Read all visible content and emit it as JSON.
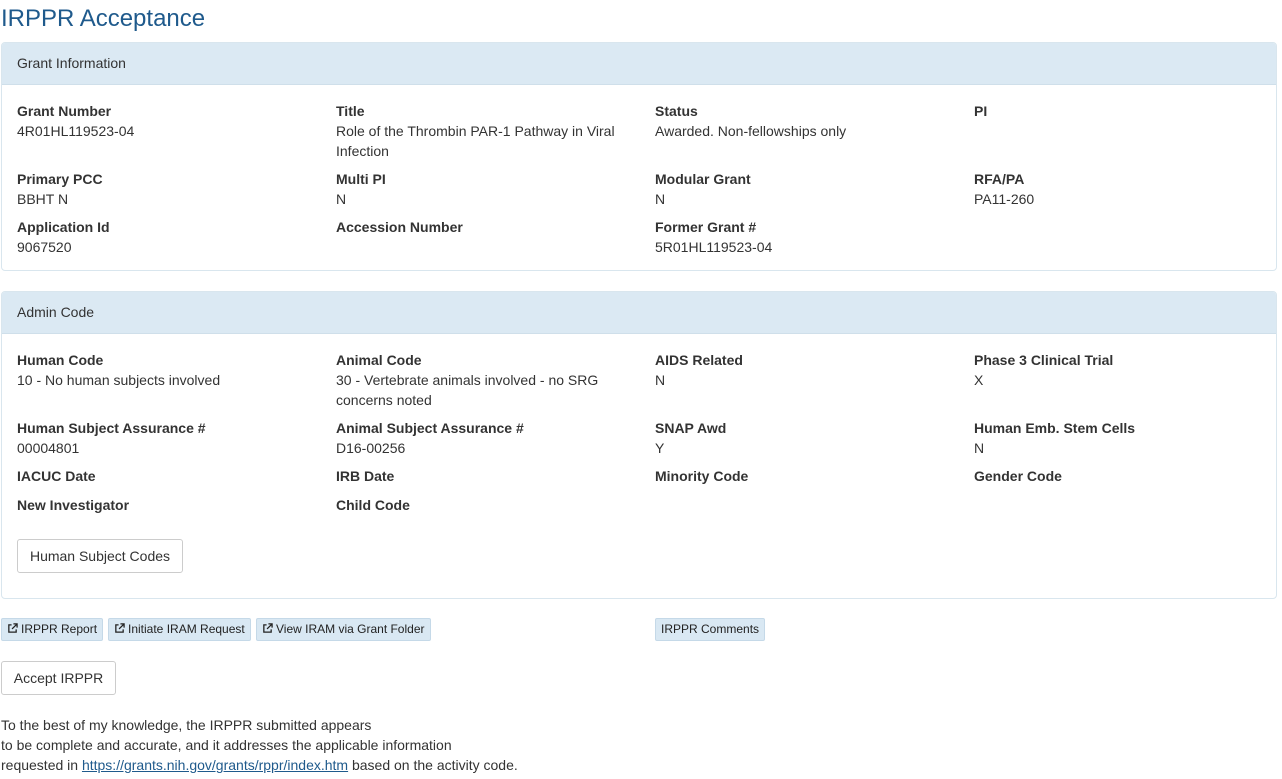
{
  "page": {
    "title": "IRPPR Acceptance"
  },
  "grant_info": {
    "heading": "Grant Information",
    "fields": [
      {
        "label": "Grant Number",
        "value": "4R01HL119523-04"
      },
      {
        "label": "Title",
        "value": "Role of the Thrombin PAR-1 Pathway in Viral Infection"
      },
      {
        "label": "Status",
        "value": "Awarded. Non-fellowships only"
      },
      {
        "label": "PI",
        "value": ""
      },
      {
        "label": "Primary PCC",
        "value": "BBHT N"
      },
      {
        "label": "Multi PI",
        "value": "N"
      },
      {
        "label": "Modular Grant",
        "value": "N"
      },
      {
        "label": "RFA/PA",
        "value": "PA11-260"
      },
      {
        "label": "Application Id",
        "value": "9067520"
      },
      {
        "label": "Accession Number",
        "value": ""
      },
      {
        "label": "Former Grant #",
        "value": "5R01HL119523-04"
      }
    ]
  },
  "admin_code": {
    "heading": "Admin Code",
    "fields": [
      {
        "label": "Human Code",
        "value": "10 - No human subjects involved"
      },
      {
        "label": "Animal Code",
        "value": "30 - Vertebrate animals involved - no SRG concerns noted"
      },
      {
        "label": "AIDS Related",
        "value": "N"
      },
      {
        "label": "Phase 3 Clinical Trial",
        "value": "X"
      },
      {
        "label": "Human Subject Assurance #",
        "value": "00004801"
      },
      {
        "label": "Animal Subject Assurance #",
        "value": "D16-00256"
      },
      {
        "label": "SNAP Awd",
        "value": "Y"
      },
      {
        "label": "Human Emb. Stem Cells",
        "value": "N"
      },
      {
        "label": "IACUC Date",
        "value": ""
      },
      {
        "label": "IRB Date",
        "value": ""
      },
      {
        "label": "Minority Code",
        "value": ""
      },
      {
        "label": "Gender Code",
        "value": ""
      },
      {
        "label": "New Investigator",
        "value": ""
      },
      {
        "label": "Child Code",
        "value": ""
      }
    ],
    "human_subject_codes_button": "Human Subject Codes"
  },
  "actions": {
    "irppr_report": "IRPPR Report",
    "initiate_iram_request": "Initiate IRAM Request",
    "view_iram": "View IRAM via Grant Folder",
    "irppr_comments": "IRPPR Comments",
    "accept_irppr": "Accept IRPPR"
  },
  "notice": {
    "line1": "To the best of my knowledge, the IRPPR submitted appears",
    "line2": "to be complete and accurate, and it addresses the applicable information",
    "line3_pre": "requested in ",
    "link_text": "https://grants.nih.gov/grants/rppr/index.htm",
    "line3_post": " based on the activity code."
  },
  "colors": {
    "title": "#1f5a8c",
    "panel_heading_bg": "#dbe9f3",
    "link_button_bg": "#d9e8f3"
  }
}
